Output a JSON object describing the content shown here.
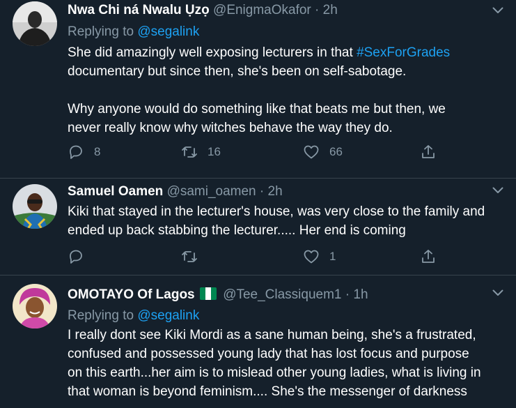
{
  "tweets": [
    {
      "name": "Nwa Chi ná Nwalu Ụzọ",
      "handle": "@EnigmaOkafor",
      "dot": "·",
      "time": "2h",
      "replying_prefix": "Replying to",
      "replying_handle": "@segalink",
      "line1_prefix": "She did amazingly well exposing lecturers in that",
      "line1_hashtag": "#SexForGrades",
      "line2": "documentary but since then, she's been on self-sabotage.",
      "line3": "Why anyone would do something like that beats me but then, we",
      "line4": "never really know why witches behave the way they do.",
      "reply_count": "8",
      "retweet_count": "16",
      "like_count": "66"
    },
    {
      "name": "Samuel Oamen",
      "handle": "@sami_oamen",
      "dot": "·",
      "time": "2h",
      "line1": "Kiki that stayed in the lecturer's house, was very close to the family and",
      "line2": "ended up back stabbing the lecturer..... Her end is coming",
      "like_count": "1"
    },
    {
      "name": "OMOTAYO Of Lagos",
      "handle": "@Tee_Classiquem1",
      "dot": "·",
      "time": "1h",
      "replying_prefix": "Replying to",
      "replying_handle": "@segalink",
      "line1": "I really dont see Kiki Mordi as a sane human being, she's a frustrated,",
      "line2": "confused and possessed young lady that has lost focus and purpose",
      "line3": "on this earth...her aim is to mislead other young ladies, what is living in",
      "line4": "that woman is beyond feminism.... She's the messenger of darkness"
    }
  ],
  "icons": {
    "reply": "reply-icon",
    "retweet": "retweet-icon",
    "like": "heart-icon",
    "share": "share-icon",
    "more": "chevron-down-icon",
    "flag": "nigeria-flag-icon"
  },
  "colors": {
    "background": "#15202b",
    "text": "#ffffff",
    "muted": "#8899a6",
    "link": "#1da1f2",
    "divider": "#38444d"
  }
}
